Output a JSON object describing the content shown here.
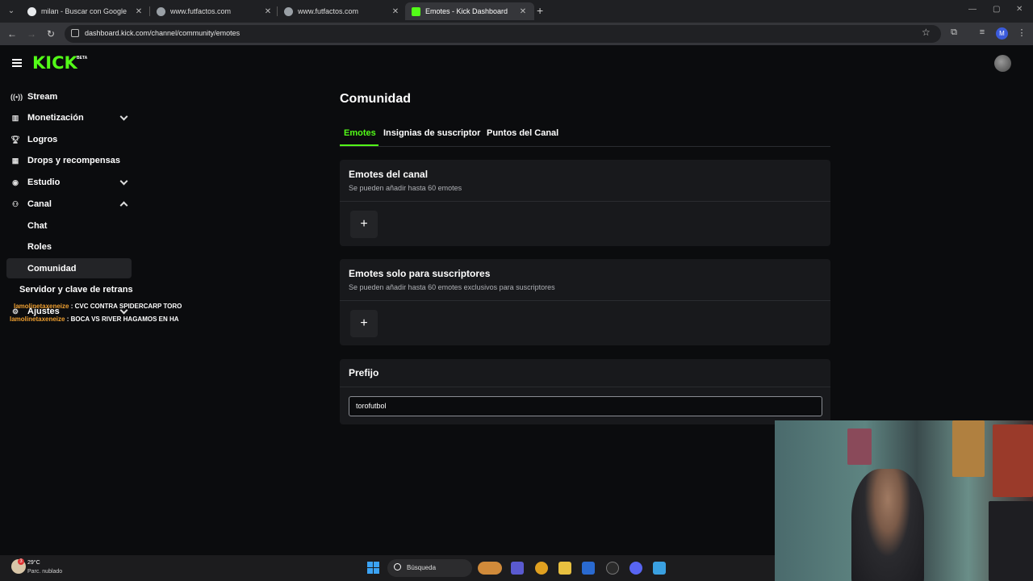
{
  "browser": {
    "tabs": [
      {
        "title": "milan - Buscar con Google",
        "active": false,
        "favicon_color": "#e8eaed"
      },
      {
        "title": "www.futfactos.com",
        "active": false,
        "favicon_color": "#9aa0a6"
      },
      {
        "title": "www.futfactos.com",
        "active": false,
        "favicon_color": "#9aa0a6"
      },
      {
        "title": "Emotes - Kick Dashboard",
        "active": true,
        "favicon_color": "#53fc18"
      }
    ],
    "url": "dashboard.kick.com/channel/community/emotes",
    "profile_initial": "M"
  },
  "kick": {
    "logo": "KICK",
    "beta": "BETA",
    "accent": "#53fc18"
  },
  "sidebar": {
    "items": [
      {
        "label": "Stream",
        "icon": "broadcast-icon"
      },
      {
        "label": "Monetización",
        "icon": "chart-icon",
        "expandable": true
      },
      {
        "label": "Logros",
        "icon": "trophy-icon"
      },
      {
        "label": "Drops y recompensas",
        "icon": "gift-icon"
      },
      {
        "label": "Estudio",
        "icon": "studio-icon",
        "expandable": true
      },
      {
        "label": "Canal",
        "icon": "users-icon",
        "expanded": true
      },
      {
        "label": "Chat",
        "sub": true
      },
      {
        "label": "Roles",
        "sub": true
      },
      {
        "label": "Comunidad",
        "sub": true,
        "active": true
      },
      {
        "label": "Servidor y clave de retrans"
      },
      {
        "label": "Ajustes",
        "icon": "gear-icon"
      }
    ]
  },
  "overlay_chat": [
    {
      "user": "lamolinetaxeneize",
      "message": ": CVC CONTRA SPIDERCARP TORO"
    },
    {
      "user": "lamolinetaxeneize",
      "message": ": BOCA VS RIVER HAGAMOS EN HA"
    }
  ],
  "main": {
    "title": "Comunidad",
    "tabs": [
      "Emotes",
      "Insignias de suscriptor",
      "Puntos del Canal"
    ],
    "sections": {
      "channel_emotes": {
        "title": "Emotes del canal",
        "subtitle": "Se pueden añadir hasta 60 emotes",
        "add": "+"
      },
      "sub_emotes": {
        "title": "Emotes solo para suscriptores",
        "subtitle": "Se pueden añadir hasta 60 emotes exclusivos para suscriptores",
        "add": "+"
      },
      "prefix": {
        "title": "Prefijo",
        "value": "torofutbol"
      }
    }
  },
  "taskbar": {
    "temperature": "29°C",
    "weather": "Parc. nublado",
    "notification_count": "3",
    "search_placeholder": "Búsqueda"
  }
}
